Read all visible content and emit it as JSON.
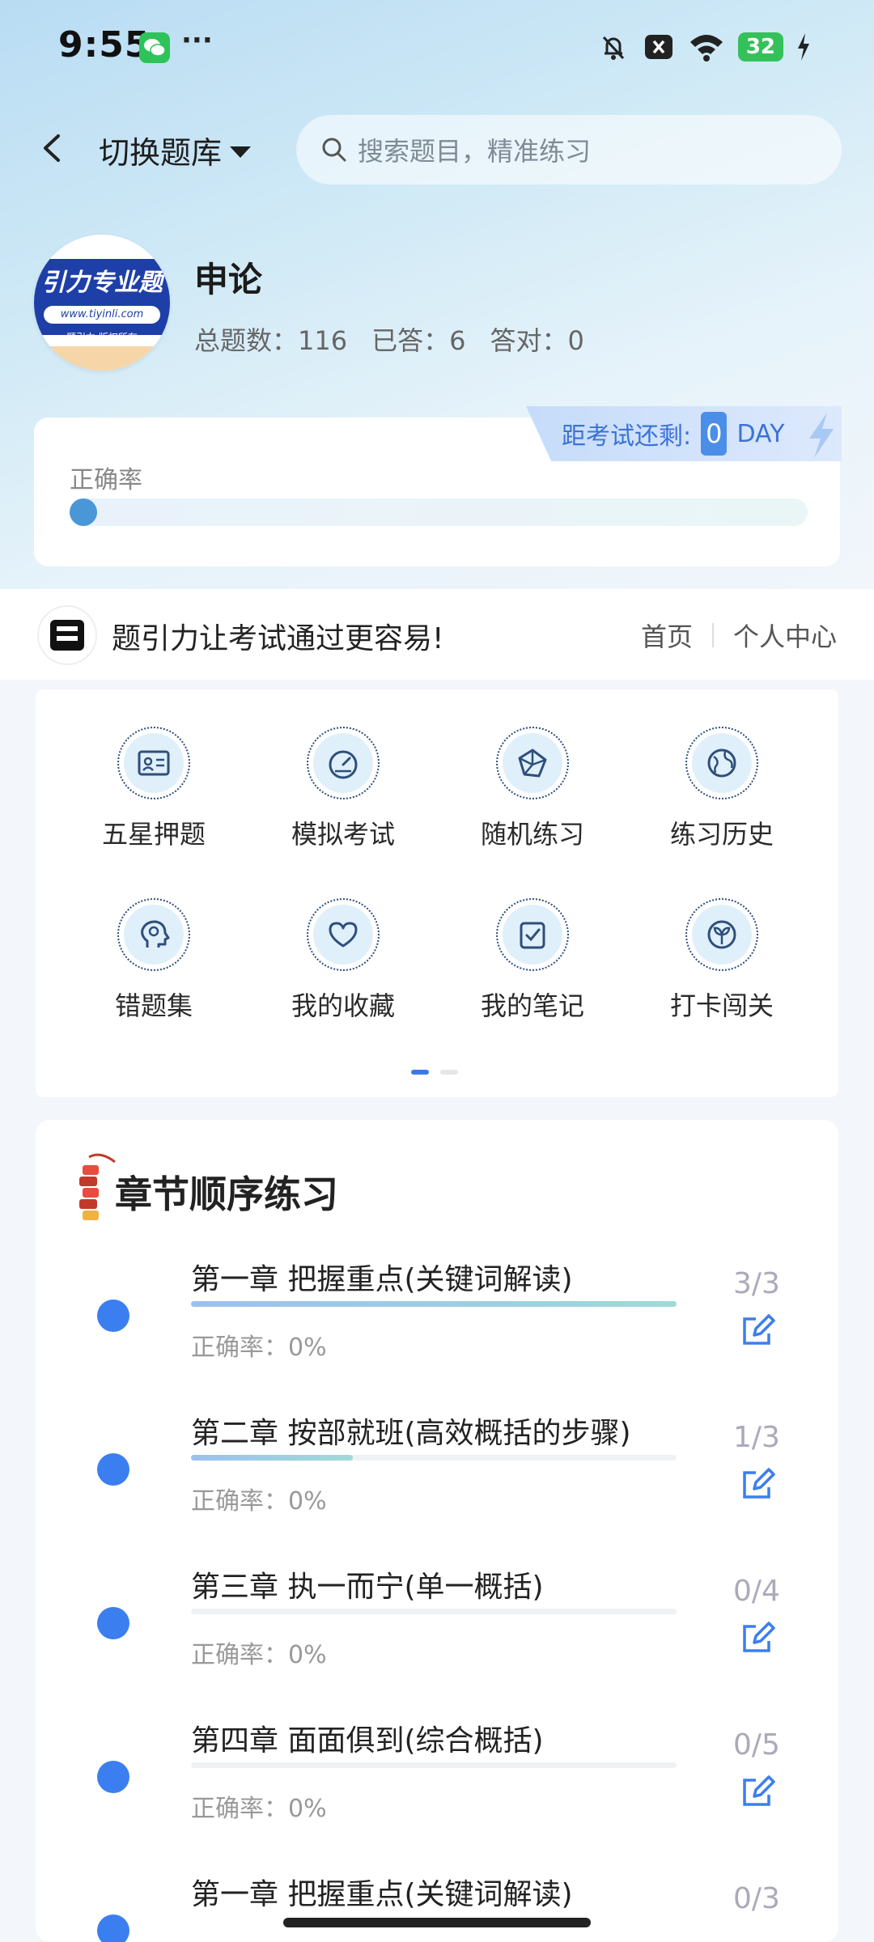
{
  "status": {
    "time": "9:55",
    "dots": "···",
    "battery": "32"
  },
  "header": {
    "switch_label": "切换题库",
    "search_placeholder": "搜索题目，精准练习"
  },
  "subject": {
    "logo_title": "引力专业题",
    "logo_url": "www.tiyinli.com",
    "logo_copy": "题引力 版权所有",
    "name": "申论",
    "total": "总题数：116",
    "answered": "已答：6",
    "correct": "答对：0"
  },
  "accuracy": {
    "label": "正确率",
    "value_fraction": 0.0
  },
  "countdown": {
    "label": "距考试还剩:",
    "value": "0",
    "unit": "DAY"
  },
  "nav": {
    "slogan": "题引力让考试通过更容易!",
    "home": "首页",
    "profile": "个人中心"
  },
  "grid": [
    {
      "label": "五星押题",
      "icon": "id-card-icon"
    },
    {
      "label": "模拟考试",
      "icon": "gauge-icon"
    },
    {
      "label": "随机练习",
      "icon": "network-icon"
    },
    {
      "label": "练习历史",
      "icon": "globe-icon"
    },
    {
      "label": "错题集",
      "icon": "head-icon"
    },
    {
      "label": "我的收藏",
      "icon": "heart-icon"
    },
    {
      "label": "我的笔记",
      "icon": "note-check-icon"
    },
    {
      "label": "打卡闯关",
      "icon": "sprout-icon"
    }
  ],
  "chapters": {
    "title": "章节顺序练习",
    "items": [
      {
        "name": "第一章 把握重点(关键词解读)",
        "acc": "正确率：0%",
        "count": "3/3",
        "progress": 1.0
      },
      {
        "name": "第二章 按部就班(高效概括的步骤)",
        "acc": "正确率：0%",
        "count": "1/3",
        "progress": 0.333
      },
      {
        "name": "第三章 执一而宁(单一概括)",
        "acc": "正确率：0%",
        "count": "0/4",
        "progress": 0.0
      },
      {
        "name": "第四章 面面俱到(综合概括)",
        "acc": "正确率：0%",
        "count": "0/5",
        "progress": 0.0
      },
      {
        "name": "第一章 把握重点(关键词解读)",
        "acc": "",
        "count": "0/3",
        "progress": 0.0
      }
    ]
  }
}
